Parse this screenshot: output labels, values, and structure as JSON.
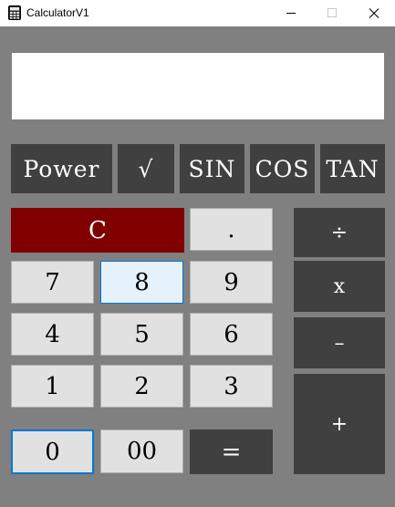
{
  "window": {
    "title": "CalculatorV1",
    "icon": "calculator-icon",
    "controls": [
      "minimize-icon",
      "maximize-icon",
      "close-icon"
    ]
  },
  "display": {
    "value": ""
  },
  "functions": {
    "power": "Power",
    "sqrt": "√",
    "sin": "SIN",
    "cos": "COS",
    "tan": "TAN"
  },
  "keys": {
    "clear": "C",
    "dot": ".",
    "seven": "7",
    "eight": "8",
    "nine": "9",
    "four": "4",
    "five": "5",
    "six": "6",
    "one": "1",
    "two": "2",
    "three": "3",
    "zero": "0",
    "double_zero": "00",
    "equals": "="
  },
  "operators": {
    "divide": "÷",
    "multiply": "x",
    "subtract": "–",
    "add": "+"
  },
  "colors": {
    "background": "#808080",
    "dark_button": "#404040",
    "light_button": "#e1e1e1",
    "clear_button": "#800000",
    "accent": "#0078d7"
  }
}
